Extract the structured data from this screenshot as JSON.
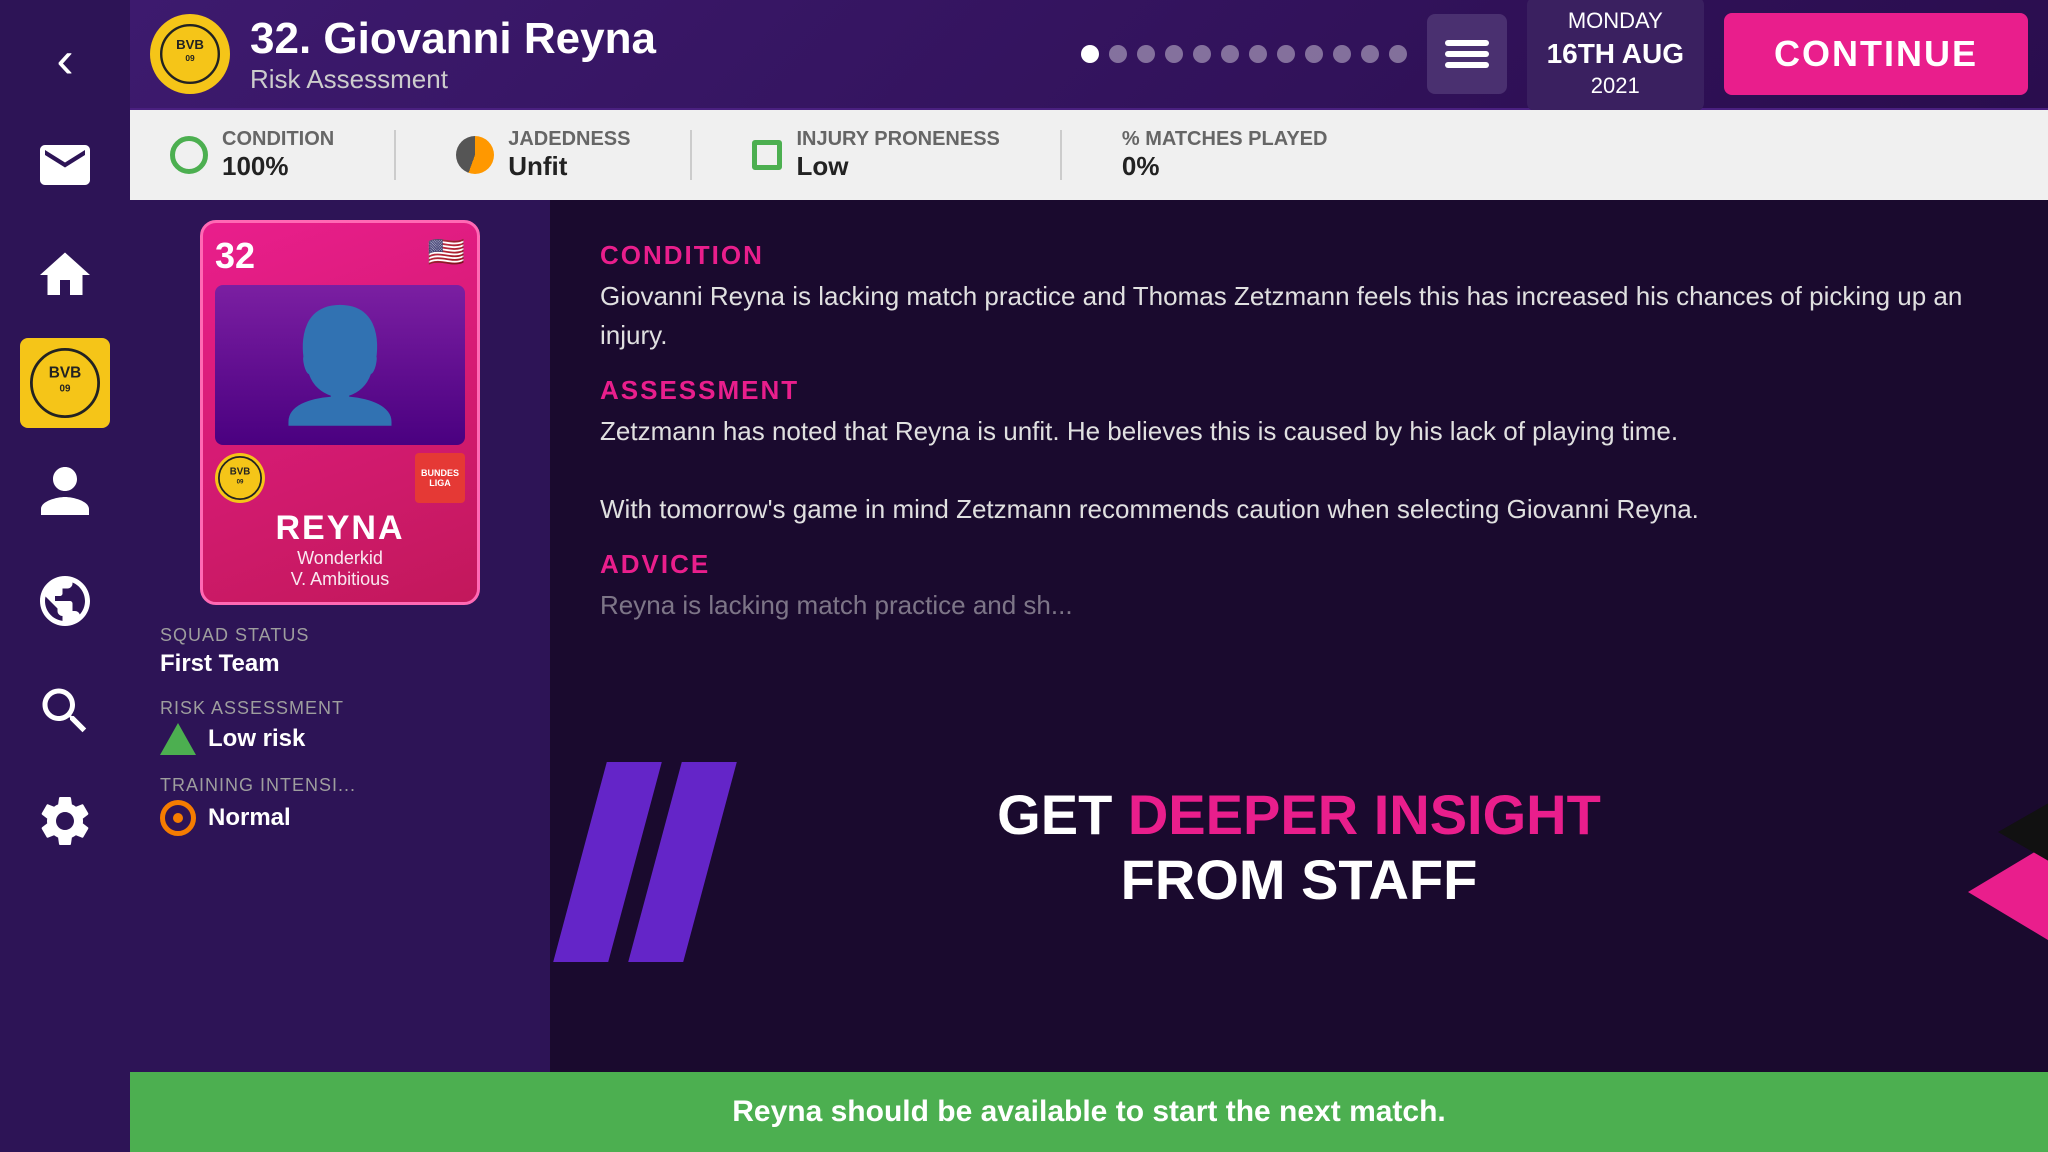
{
  "sidebar": {
    "back_label": "‹",
    "icons": [
      "mail",
      "home",
      "club",
      "person",
      "globe",
      "search",
      "settings"
    ]
  },
  "header": {
    "player_number": "32",
    "player_name": "32. Giovanni Reyna",
    "subtitle": "Risk Assessment",
    "dots_count": 12,
    "active_dot": 0,
    "menu_label": "menu",
    "date_line1": "MONDAY",
    "date_line2": "16TH AUG",
    "date_line3": "2021",
    "continue_label": "CONTINUE"
  },
  "stats": {
    "condition_label": "CONDITION",
    "condition_value": "100%",
    "jadedness_label": "JADEDNESS",
    "jadedness_value": "Unfit",
    "injury_label": "INJURY PRONENESS",
    "injury_value": "Low",
    "matches_label": "% MATCHES PLAYED",
    "matches_value": "0%"
  },
  "player_card": {
    "number": "32",
    "name": "REYNA",
    "descriptor1": "Wonderkid",
    "descriptor2": "V. Ambitious",
    "flag_emoji": "🇺🇸"
  },
  "left_panel": {
    "squad_status_label": "SQUAD STATUS",
    "squad_status_value": "First Team",
    "risk_label": "RISK ASSESSMENT",
    "risk_value": "Low risk",
    "training_label": "TRAINING INTENSI...",
    "training_value": "Normal"
  },
  "main_content": {
    "condition_section_title": "CONDITION",
    "condition_text": "Giovanni Reyna is lacking match practice and Thomas Zetzmann feels this has increased his chances of picking up an injury.",
    "assessment_section_title": "ASSESSMENT",
    "assessment_text": "Zetzmann has noted that Reyna is unfit. He believes this is caused by his lack of playing time.\n\nWith tomorrow's game in mind Zetzmann recommends caution when selecting Giovanni Reyna.",
    "advice_section_title": "ADVICE",
    "advice_text": "Reyna is lacking match practice and sh...",
    "insight_line1": "GET DEEPER INSIGHT",
    "insight_line1_part1": "GET ",
    "insight_line1_part2": "DEEPER INSIGHT",
    "insight_line2": "FROM STAFF"
  },
  "bottom_banner": {
    "text": "Reyna should be available to start the next match."
  }
}
